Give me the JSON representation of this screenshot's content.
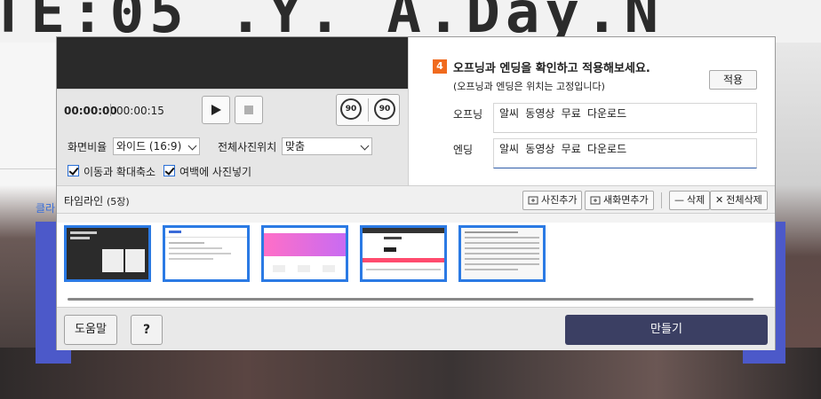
{
  "background": {
    "bg_text": "TE:05 .Y. A.Day.N",
    "left_text": "클라"
  },
  "player": {
    "current_time": "00:00:00",
    "total_time": "00:00:15",
    "rotate_left_label": "90",
    "rotate_right_label": "90"
  },
  "options": {
    "ratio_label": "화면비율",
    "ratio_value": "와이드 (16:9)",
    "position_label": "전체사진위치",
    "position_value": "맞춤",
    "move_zoom_label": "이동과 확대축소",
    "fill_margin_label": "여백에 사진넣기"
  },
  "step": {
    "number": "4",
    "title": "오프닝과 엔딩을 확인하고 적용해보세요.",
    "subtitle": "(오프닝과 엔딩은 위치는 고정입니다)",
    "apply_label": "적용",
    "opening_label": "오프닝",
    "opening_value": "알씨 동영상 무료 다운로드",
    "ending_label": "엔딩",
    "ending_value": "알씨 동영상 무료 다운로드"
  },
  "timeline": {
    "title": "타임라인",
    "count": "(5장)",
    "add_photo": "사진추가",
    "add_screen": "새화면추가",
    "delete": "삭제",
    "delete_all": "전체삭제",
    "thumbnails": [
      {
        "id": "thumb-1"
      },
      {
        "id": "thumb-2"
      },
      {
        "id": "thumb-3"
      },
      {
        "id": "thumb-4"
      },
      {
        "id": "thumb-5"
      }
    ]
  },
  "footer": {
    "help_label": "도움말",
    "question_label": "?",
    "make_label": "만들기"
  },
  "colors": {
    "accent": "#2b7ae4",
    "step_badge": "#f06a1e",
    "make_button": "#3b3f63"
  }
}
